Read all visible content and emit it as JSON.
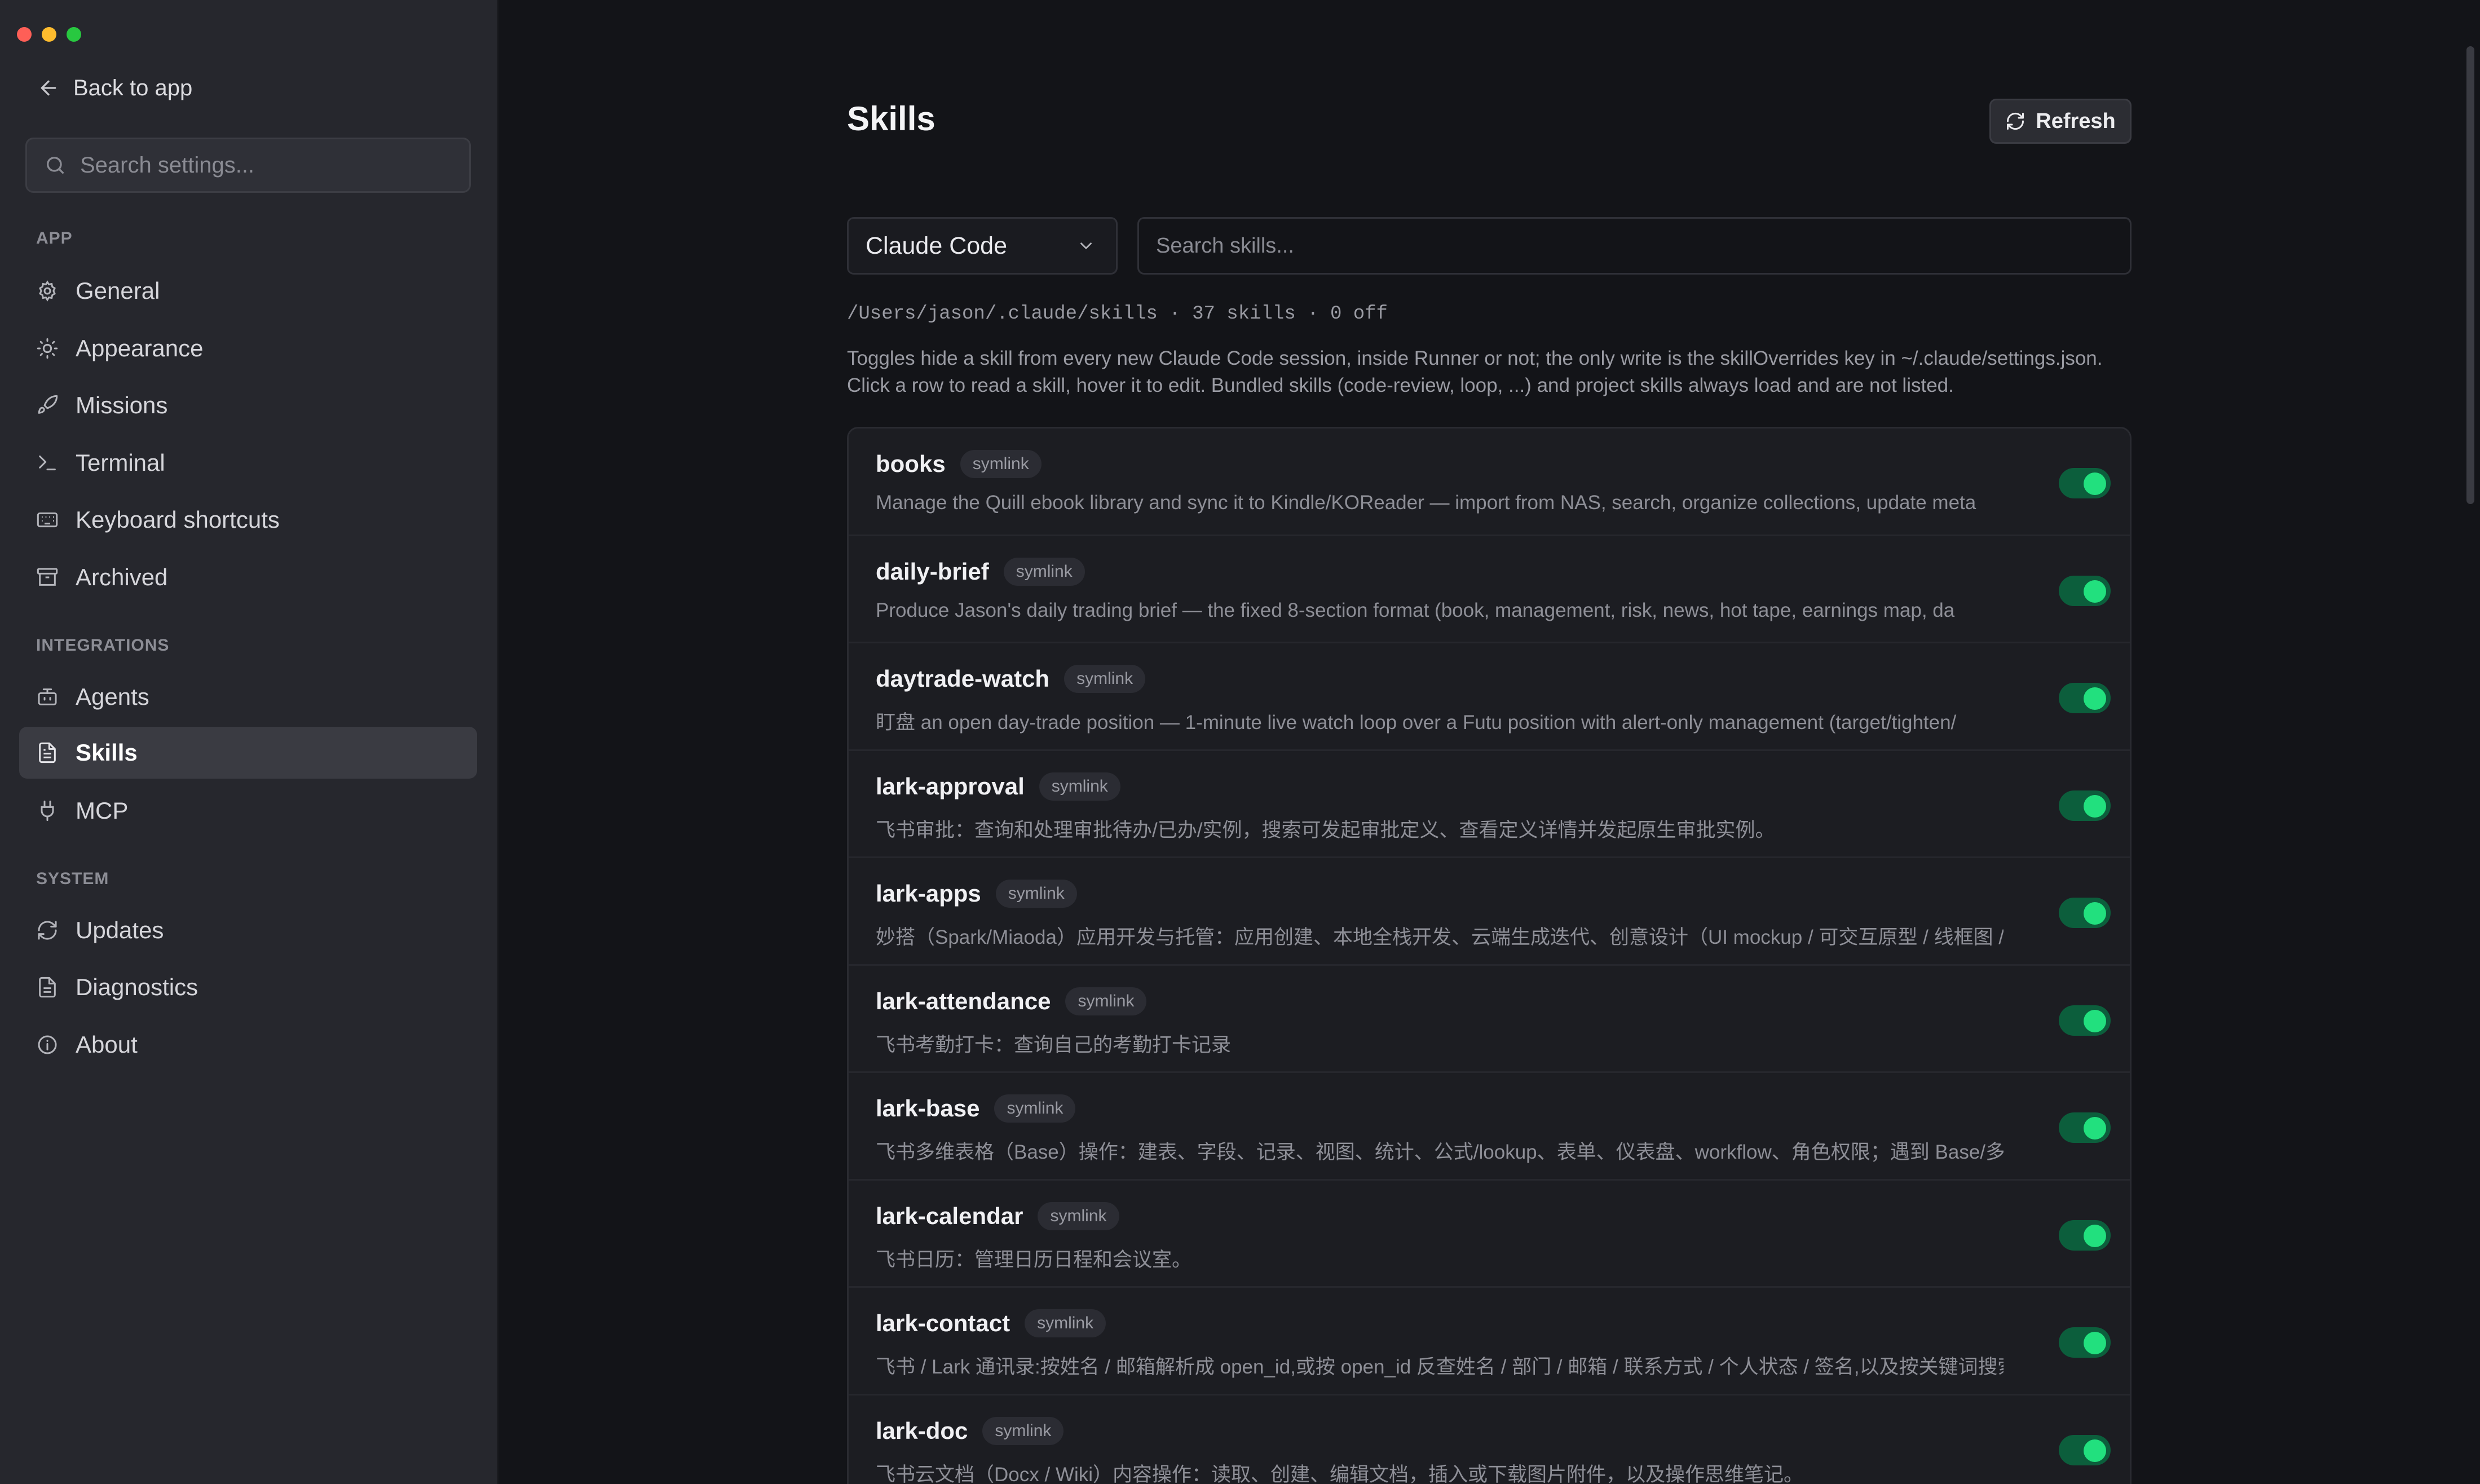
{
  "sidebar": {
    "back_label": "Back to app",
    "search_placeholder": "Search settings...",
    "sections": {
      "app": "APP",
      "integrations": "INTEGRATIONS",
      "system": "SYSTEM"
    },
    "items": {
      "general": "General",
      "appearance": "Appearance",
      "missions": "Missions",
      "terminal": "Terminal",
      "shortcuts": "Keyboard shortcuts",
      "archived": "Archived",
      "agents": "Agents",
      "skills": "Skills",
      "mcp": "MCP",
      "updates": "Updates",
      "diagnostics": "Diagnostics",
      "about": "About"
    },
    "active_item": "Skills"
  },
  "main": {
    "title": "Skills",
    "refresh_label": "Refresh",
    "selector_value": "Claude Code",
    "search_placeholder": "Search skills...",
    "path_line": "/Users/jason/.claude/skills · 37 skills · 0 off",
    "description_1": "Toggles hide a skill from every new Claude Code session, inside Runner or not; the only write is the skillOverrides key in ~/.claude/settings.json.",
    "description_2": "Click a row to read a skill, hover it to edit. Bundled skills (code-review, loop, ...) and project skills always load and are not listed.",
    "skills": [
      {
        "name": "books",
        "badge": "symlink",
        "desc": "Manage the Quill ebook library and sync it to Kindle/KOReader — import from NAS, search, organize collections, update meta",
        "enabled": true
      },
      {
        "name": "daily-brief",
        "badge": "symlink",
        "desc": "Produce Jason's daily trading brief — the fixed 8-section format (book, management, risk, news, hot tape, earnings map, da",
        "enabled": true
      },
      {
        "name": "daytrade-watch",
        "badge": "symlink",
        "desc": "盯盘 an open day-trade position — 1-minute live watch loop over a Futu position with alert-only management (target/tighten/",
        "enabled": true
      },
      {
        "name": "lark-approval",
        "badge": "symlink",
        "desc": "飞书审批：查询和处理审批待办/已办/实例，搜索可发起审批定义、查看定义详情并发起原生审批实例。",
        "enabled": true
      },
      {
        "name": "lark-apps",
        "badge": "symlink",
        "desc": "妙搭（Spark/Miaoda）应用开发与托管：应用创建、本地全栈开发、云端生成迭代、创意设计（UI mockup / 可交互原型 / 线框图 / 子",
        "enabled": true
      },
      {
        "name": "lark-attendance",
        "badge": "symlink",
        "desc": "飞书考勤打卡：查询自己的考勤打卡记录",
        "enabled": true
      },
      {
        "name": "lark-base",
        "badge": "symlink",
        "desc": "飞书多维表格（Base）操作：建表、字段、记录、视图、统计、公式/lookup、表单、仪表盘、workflow、角色权限；遇到 Base/多维",
        "enabled": true
      },
      {
        "name": "lark-calendar",
        "badge": "symlink",
        "desc": "飞书日历：管理日历日程和会议室。",
        "enabled": true
      },
      {
        "name": "lark-contact",
        "badge": "symlink",
        "desc": "飞书 / Lark 通讯录:按姓名 / 邮箱解析成 open_id,或按 open_id 反查姓名 / 部门 / 邮箱 / 联系方式 / 个人状态 / 签名,以及按关键词搜索",
        "enabled": true
      },
      {
        "name": "lark-doc",
        "badge": "symlink",
        "desc": "飞书云文档（Docx / Wiki）内容操作：读取、创建、编辑文档，插入或下载图片附件，以及操作思维笔记。",
        "enabled": true
      }
    ]
  }
}
